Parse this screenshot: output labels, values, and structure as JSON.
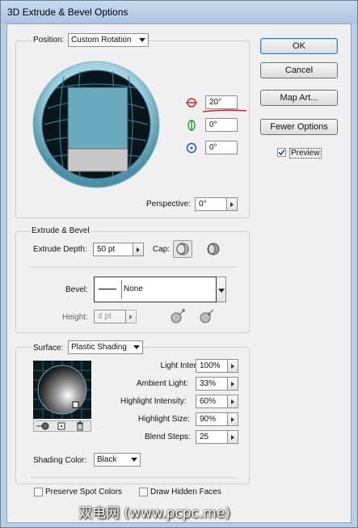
{
  "window": {
    "title": "3D Extrude & Bevel Options"
  },
  "buttons": {
    "ok": "OK",
    "cancel": "Cancel",
    "map_art": "Map Art...",
    "fewer_options": "Fewer Options"
  },
  "preview": {
    "label": "Preview",
    "checked": true
  },
  "position": {
    "group_label": "Position:",
    "preset": "Custom Rotation",
    "rotate_x": "20°",
    "rotate_y": "0°",
    "rotate_z": "0°",
    "perspective_label": "Perspective:",
    "perspective": "0°"
  },
  "extrude": {
    "group_label": "Extrude & Bevel",
    "depth_label": "Extrude Depth:",
    "depth": "50 pt",
    "cap_label": "Cap:",
    "bevel_label": "Bevel:",
    "bevel": "None",
    "height_label": "Height:",
    "height": "4 pt"
  },
  "surface": {
    "label": "Surface:",
    "type": "Plastic Shading",
    "light_intensity_label": "Light Intensity:",
    "light_intensity": "100%",
    "ambient_light_label": "Ambient Light:",
    "ambient_light": "33%",
    "highlight_intensity_label": "Highlight Intensity:",
    "highlight_intensity": "60%",
    "highlight_size_label": "Highlight Size:",
    "highlight_size": "90%",
    "blend_steps_label": "Blend Steps:",
    "blend_steps": "25",
    "shading_color_label": "Shading Color:",
    "shading_color": "Black"
  },
  "options": {
    "preserve_spot": "Preserve Spot Colors",
    "draw_hidden": "Draw Hidden Faces"
  },
  "watermark": "双电网 (www.pcpc.me)",
  "colors": {
    "accent_blue": "#5aa3bd",
    "face_light": "#69aabd",
    "face_grey": "#c8c8c8",
    "annotation_red": "#d9262c"
  }
}
